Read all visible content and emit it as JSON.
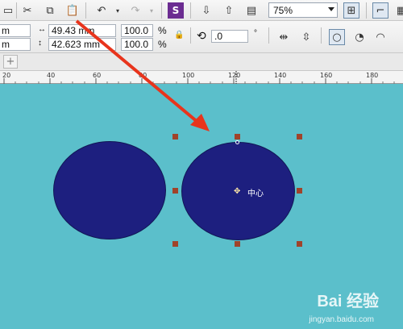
{
  "toolbar": {
    "zoom_value": "75%"
  },
  "property_bar": {
    "x_unit_top": "m",
    "x_unit_bottom": "m",
    "width_value": "49.43 mm",
    "height_value": "42.623 mm",
    "scale_x": "100.0",
    "scale_y": "100.0",
    "percent_sign_1": "%",
    "percent_sign_2": "%",
    "rotation_value": ".0",
    "degree_sign": "°"
  },
  "tabs": {
    "add_label": "+"
  },
  "ruler": {
    "ticks": [
      "20",
      "40",
      "60",
      "80",
      "100",
      "120",
      "140",
      "160",
      "180"
    ]
  },
  "canvas": {
    "center_label": "中心",
    "shape_fill": "#1d1f7f",
    "background": "#5bbfcb",
    "handle_color": "#a0432a",
    "arrow_color": "#e8341c"
  },
  "watermark": {
    "brand": "Bai 经验",
    "url": "jingyan.baidu.com"
  }
}
